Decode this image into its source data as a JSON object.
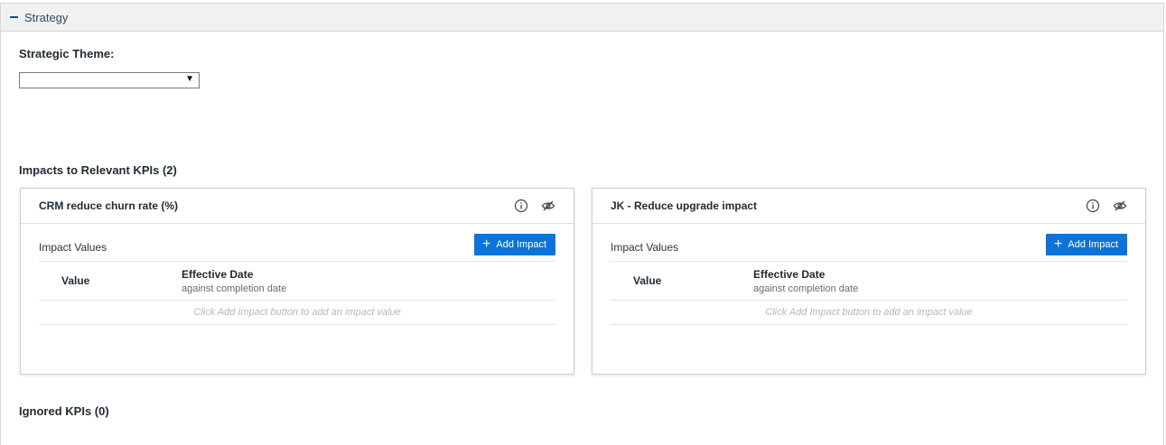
{
  "section": {
    "title": "Strategy"
  },
  "strategic_theme": {
    "label": "Strategic Theme:",
    "selected": ""
  },
  "impacts": {
    "heading": "Impacts to Relevant KPIs (2)",
    "cards": [
      {
        "title": "CRM reduce churn rate (%)",
        "impact_values_label": "Impact Values",
        "add_button": "Add Impact",
        "col_value": "Value",
        "col_date": "Effective Date",
        "col_date_sub": "against completion date",
        "empty_text": "Click Add Impact button to add an impact value"
      },
      {
        "title": "JK - Reduce upgrade impact",
        "impact_values_label": "Impact Values",
        "add_button": "Add Impact",
        "col_value": "Value",
        "col_date": "Effective Date",
        "col_date_sub": "against completion date",
        "empty_text": "Click Add Impact button to add an impact value"
      }
    ]
  },
  "ignored": {
    "heading": "Ignored KPIs (0)"
  },
  "colors": {
    "accent": "#0b73da",
    "header_bg": "#f1f1f1"
  }
}
